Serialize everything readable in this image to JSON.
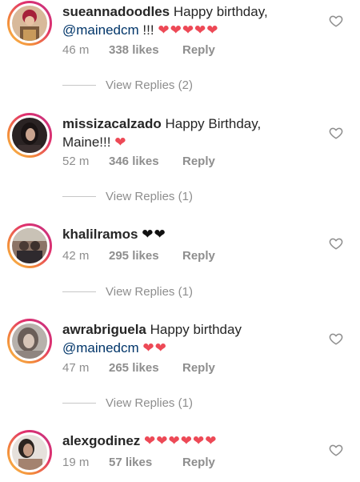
{
  "comments": [
    {
      "username": "sueannadoodles",
      "text": "Happy birthday,",
      "mention": "@mainedcm",
      "suffix": "!!!",
      "hearts": "❤❤❤❤❤",
      "time": "46 m",
      "likes": "338 likes",
      "reply": "Reply",
      "view_replies": "View Replies (2)"
    },
    {
      "username": "missizacalzado",
      "text": "Happy Birthday,",
      "line2": "Maine!!!",
      "hearts": "❤",
      "time": "52 m",
      "likes": "346 likes",
      "reply": "Reply",
      "view_replies": "View Replies (1)"
    },
    {
      "username": "khalilramos",
      "hearts": "❤❤",
      "time": "42 m",
      "likes": "295 likes",
      "reply": "Reply",
      "view_replies": "View Replies (1)"
    },
    {
      "username": "awrabriguela",
      "text": "Happy birthday",
      "mention": "@mainedcm",
      "hearts": "❤❤",
      "time": "47 m",
      "likes": "265 likes",
      "reply": "Reply",
      "view_replies": "View Replies (1)"
    },
    {
      "username": "alexgodinez",
      "hearts": "❤❤❤❤❤❤",
      "time": "19 m",
      "likes": "57 likes",
      "reply": "Reply"
    }
  ],
  "icons": {
    "like": "heart-outline-icon"
  },
  "colors": {
    "heart_red": "#ed4956",
    "meta_gray": "#8e8e8e",
    "mention_blue": "#003569"
  }
}
